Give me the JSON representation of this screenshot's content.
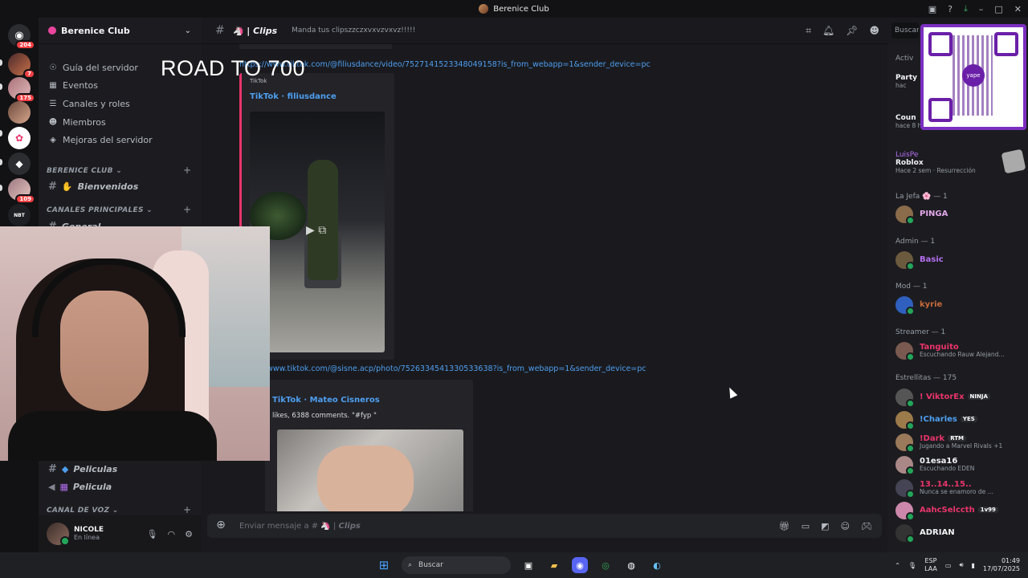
{
  "window": {
    "title": "Berenice Club"
  },
  "guilds": [
    {
      "badge": "204"
    },
    {
      "badge": "7"
    },
    {
      "badge": "175"
    },
    {
      "badge": ""
    },
    {
      "badge": ""
    },
    {
      "badge": ""
    },
    {
      "badge": "109"
    },
    {
      "badge": ""
    }
  ],
  "guild_labels": {
    "nbt": "NBT"
  },
  "sidebar": {
    "server_name": "Berenice Club",
    "nav": [
      {
        "label": "Guía del servidor",
        "icon": "compass-icon"
      },
      {
        "label": "Eventos",
        "icon": "calendar-icon"
      },
      {
        "label": "Canales y roles",
        "icon": "list-icon"
      },
      {
        "label": "Miembros",
        "icon": "people-icon"
      },
      {
        "label": "Mejoras del servidor",
        "icon": "boost-icon"
      }
    ],
    "category1": "BERENICE CLUB",
    "channel_welcome": "Bienvenidos",
    "category2": "CANALES PRINCIPALES",
    "channel_general": "General",
    "channel_peliculas": "Peliculas",
    "channel_pelicula": "Pelicula",
    "category3": "CANAL DE VOZ"
  },
  "user": {
    "name": "NICOLE",
    "status": "En línea"
  },
  "overlay": {
    "text": "ROAD TO 700"
  },
  "chat": {
    "channel": "Clips",
    "topic": "Manda tus clipszzczxvxvzvxvz!!!!!",
    "search_placeholder": "Buscar"
  },
  "messages": {
    "link1": "https://www.tiktok.com/@filiusdance/video/7527141523348049158?is_from_webapp=1&sender_device=pc",
    "embed1_provider": "TikTok",
    "embed1_title": "TikTok · filiusdance",
    "link2": "https://www.tiktok.com/@sisne.acp/photo/7526334541330533638?is_from_webapp=1&sender_device=pc",
    "embed2_title": "TikTok · Mateo Cisneros",
    "embed2_desc": "likes, 6388 comments. \"#fyp \""
  },
  "composer": {
    "placeholder": "Enviar mensaje a #",
    "channel": "Clips"
  },
  "members": {
    "activity_header": "Activ",
    "activity": [
      {
        "name": "Party",
        "sub": "hac"
      },
      {
        "name": "Coun",
        "sub": "hace 8 h"
      },
      {
        "user": "LuisPe",
        "name": "Roblox",
        "sub": "Hace 2 sem",
        "extra": "Resurrección"
      }
    ],
    "sections": [
      {
        "label": "La Jefa 🌸 — 1",
        "members": [
          {
            "name": "PINGA",
            "status": "",
            "color": "#e0a7e8",
            "av": "#8a6b4a"
          }
        ]
      },
      {
        "label": "Admin — 1",
        "members": [
          {
            "name": "Basic",
            "status": "",
            "color": "#b46ef0",
            "av": "#6b5a3e"
          }
        ]
      },
      {
        "label": "Mod — 1",
        "members": [
          {
            "name": "kyrie",
            "status": "",
            "color": "#c66b3a",
            "av": "#2f5fbf"
          }
        ]
      },
      {
        "label": "Streamer — 1",
        "members": [
          {
            "name": "Tanguito",
            "status": "Escuchando Rauw Alejand...",
            "color": "#e9346a",
            "av": "#7a5a50"
          }
        ]
      },
      {
        "label": "Estrellitas — 175",
        "members": [
          {
            "name": "! ViktorEx",
            "status": "",
            "color": "#e9346a",
            "tag": "NINJA",
            "av": "#555"
          },
          {
            "name": "!Charles",
            "status": "",
            "color": "#4e9ff0",
            "tag": "YES",
            "av": "#9c7a4a"
          },
          {
            "name": "!Dark",
            "status": "Jugando a Marvel Rivals +1",
            "color": "#e9346a",
            "tag": "RTM",
            "av": "#9a7a5a"
          },
          {
            "name": "01esa16",
            "status": "Escuchando EDEN",
            "color": "#f2f3f5",
            "av": "#a88"
          },
          {
            "name": "13..14..15..",
            "status": "Nunca se enamoro de ...",
            "color": "#e9346a",
            "av": "#445"
          },
          {
            "name": "AahcSelccth",
            "status": "",
            "color": "#e9346a",
            "tag": "1v99",
            "av": "#c8a"
          },
          {
            "name": "ADRIAN",
            "status": "",
            "color": "#f2f3f5",
            "av": "#333"
          }
        ]
      }
    ]
  },
  "qr": {
    "label": "yape"
  },
  "taskbar": {
    "search": "Buscar",
    "lang1": "ESP",
    "lang2": "LAA",
    "time": "01:49",
    "date": "17/07/2025"
  }
}
